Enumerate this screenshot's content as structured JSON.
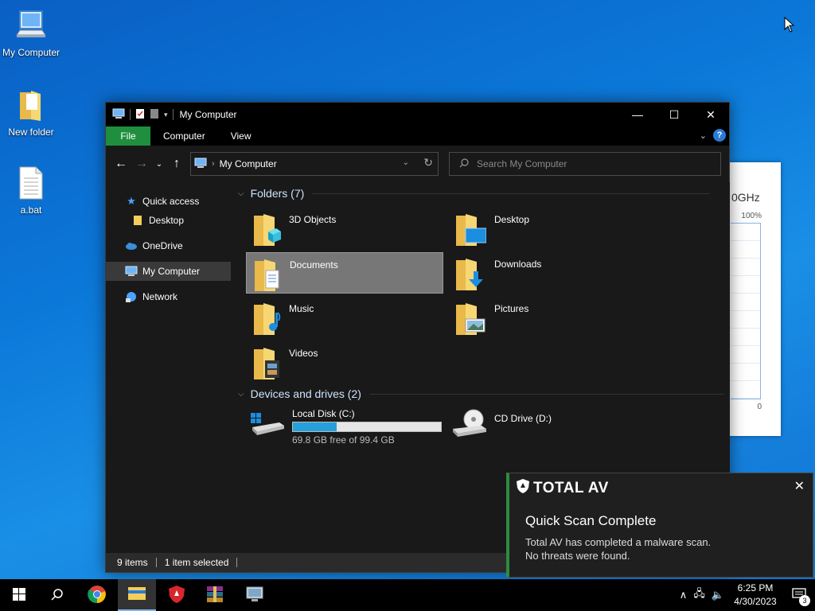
{
  "desktop": {
    "icons": [
      {
        "label": "My Computer",
        "icon": "computer-icon"
      },
      {
        "label": "New folder",
        "icon": "folder-icon"
      },
      {
        "label": "a.bat",
        "icon": "batch-file-icon"
      }
    ]
  },
  "background_window": {
    "ghz_text": "0GHz",
    "pct_label": "100%",
    "zero_label": "0"
  },
  "explorer": {
    "title": "My Computer",
    "ribbon_tabs": [
      "File",
      "Computer",
      "View"
    ],
    "address": "My Computer",
    "search_placeholder": "Search My Computer",
    "nav": {
      "quick_access": "Quick access",
      "desktop": "Desktop",
      "onedrive": "OneDrive",
      "my_computer": "My Computer",
      "network": "Network"
    },
    "folders_header": "Folders (7)",
    "folders": [
      {
        "name": "3D Objects",
        "icon": "3d-objects-folder-icon"
      },
      {
        "name": "Desktop",
        "icon": "desktop-folder-icon"
      },
      {
        "name": "Documents",
        "icon": "documents-folder-icon",
        "selected": true
      },
      {
        "name": "Downloads",
        "icon": "downloads-folder-icon"
      },
      {
        "name": "Music",
        "icon": "music-folder-icon"
      },
      {
        "name": "Pictures",
        "icon": "pictures-folder-icon"
      },
      {
        "name": "Videos",
        "icon": "videos-folder-icon"
      }
    ],
    "devices_header": "Devices and drives (2)",
    "drives": [
      {
        "name": "Local Disk (C:)",
        "free_text": "69.8 GB free of 99.4 GB",
        "used_fraction": 0.298
      },
      {
        "name": "CD Drive (D:)"
      }
    ],
    "status": {
      "items": "9 items",
      "selected": "1 item selected"
    }
  },
  "toast": {
    "brand": "TOTAL AV",
    "headline": "Quick Scan Complete",
    "line1": "Total AV has completed a malware scan.",
    "line2": "No threats were found."
  },
  "taskbar": {
    "time": "6:25 PM",
    "date": "4/30/2023",
    "notification_count": "3"
  },
  "colors": {
    "ribbon_file_tab": "#1f8f3e",
    "drive_bar_fill": "#26a0da",
    "toast_accent": "#2e8b3e"
  }
}
